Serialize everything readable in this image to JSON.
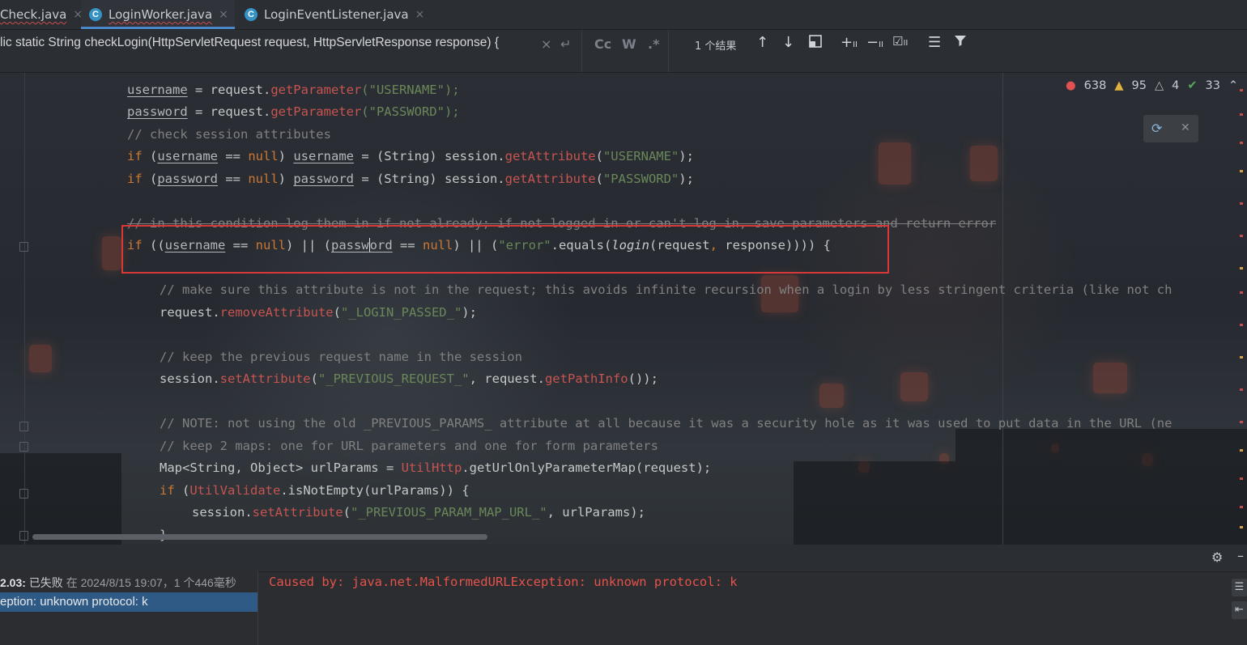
{
  "tabs": [
    {
      "label": "Check.java",
      "active": false,
      "icon": "none"
    },
    {
      "label": "LoginWorker.java",
      "active": true,
      "icon": "class-icon",
      "badge": "C"
    },
    {
      "label": "LoginEventListener.java",
      "active": false,
      "icon": "class-icon",
      "badge": "C"
    }
  ],
  "tab_close_glyph": "×",
  "search": {
    "query": "lic static String checkLogin(HttpServletRequest request, HttpServletResponse response) {",
    "match_case": "Cc",
    "words": "W",
    "regex": ".*",
    "result_count": "1 个结果"
  },
  "inspections": {
    "errors": "638",
    "warnings": "95",
    "weak_warnings": "4",
    "typos": "33"
  },
  "code": {
    "line1": "username = request.getParameter(\"USERNAME\");",
    "l1_var": "username",
    "l1_a": " = request.",
    "l1_fn": "getParameter",
    "l1_s": "(\"USERNAME\");",
    "l2_var": "password",
    "l2_a": " = request.",
    "l2_fn": "getParameter",
    "l2_s": "(\"PASSWORD\");",
    "l3": "// check session attributes",
    "l4_kw": "if",
    "l4_a": " (",
    "l4_v1": "username",
    "l4_b": " == ",
    "l4_null": "null",
    "l4_c": ") ",
    "l4_v2": "username",
    "l4_d": " = (String) session.",
    "l4_fn": "getAttribute",
    "l4_e": "(",
    "l4_str": "\"USERNAME\"",
    "l4_f": ");",
    "l5_v1": "password",
    "l5_v2": "password",
    "l5_str": "\"PASSWORD\"",
    "l6": "// in this condition log them in if not already; if not logged in or can't log in, save parameters and return error",
    "l7_a": " ((",
    "l7_v1": "username",
    "l7_b": " == ",
    "l7_null1": "null",
    "l7_c": ") || (",
    "l7_v2a": "passw",
    "l7_v2b": "ord",
    "l7_d": " == ",
    "l7_null2": "null",
    "l7_e": ") || (",
    "l7_str": "\"error\"",
    "l7_f": ".equals(",
    "l7_login": "login",
    "l7_g": "(request",
    "l7_comma": ",",
    "l7_h": " response)))) {",
    "l8": "// make sure this attribute is not in the request; this avoids infinite recursion when a login by less stringent criteria (like not ch",
    "l9_a": "request.",
    "l9_fn": "removeAttribute",
    "l9_b": "(",
    "l9_str": "\"_LOGIN_PASSED_\"",
    "l9_c": ");",
    "l10": "// keep the previous request name in the session",
    "l11_a": "session.",
    "l11_fn": "setAttribute",
    "l11_b": "(",
    "l11_str": "\"_PREVIOUS_REQUEST_\"",
    "l11_c": ", request.",
    "l11_fn2": "getPathInfo",
    "l11_d": "());",
    "l12": "// NOTE: not using the old _PREVIOUS_PARAMS_ attribute at all because it was a security hole as it was used to put data in the URL (ne",
    "l13": "// keep 2 maps: one for URL parameters and one for form parameters",
    "l14_a": "Map<String, Object> urlParams = ",
    "l14_cls": "UtilHttp",
    "l14_b": ".getUrlOnlyParameterMap(request);",
    "l15_kw": "if",
    "l15_a": " (",
    "l15_cls": "UtilValidate",
    "l15_b": ".isNotEmpty(urlParams)) {",
    "l16_a": "session.",
    "l16_fn": "setAttribute",
    "l16_b": "(",
    "l16_str": "\"_PREVIOUS_PARAM_MAP_URL_\"",
    "l16_c": ", urlParams);",
    "l17": "}"
  },
  "run": {
    "status_prefix": "2.03:",
    "status_failed": "已失败",
    "status_detail": "在 2024/8/15 19:07，1 个446毫秒",
    "selected_item": "eption: unknown protocol: k",
    "console_line": "Caused by: java.net.MalformedURLException: unknown protocol: k"
  },
  "colors": {
    "accent": "#4a88c7",
    "error": "#e5534b",
    "highlight_box": "#d93838"
  }
}
